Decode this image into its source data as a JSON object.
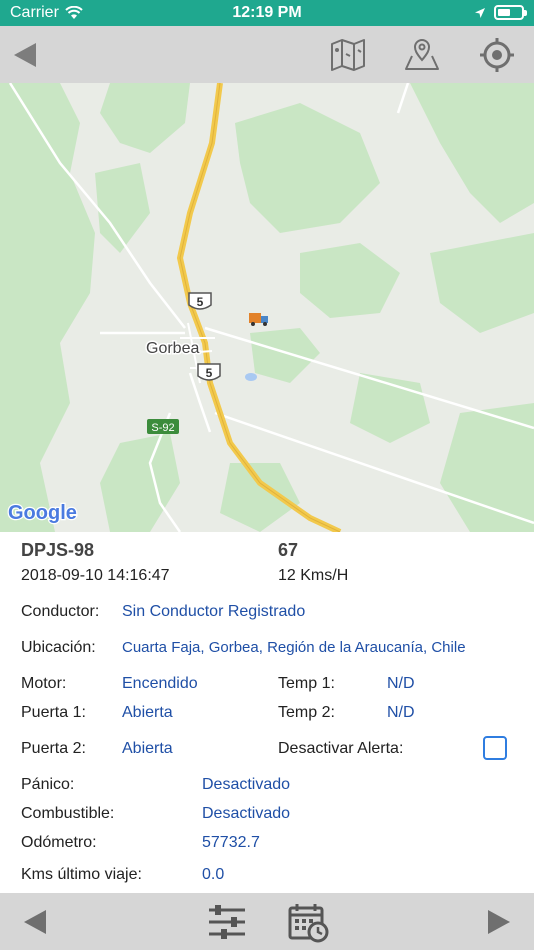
{
  "status_bar": {
    "carrier": "Carrier",
    "time": "12:19 PM",
    "battery_level": 0.55,
    "background_color": "#1fa88f"
  },
  "toolbar": {
    "back_icon": "triangle-left-icon",
    "icons": [
      "map-icon",
      "map-pin-icon",
      "crosshair-locate-icon"
    ]
  },
  "map": {
    "labels": {
      "town": "Gorbea",
      "route_5a": "5",
      "route_5b": "5",
      "route_s92": "S-92",
      "logo": "Google"
    }
  },
  "vehicle": {
    "plate": "DPJS-98",
    "number": "67",
    "datetime": "2018-09-10 14:16:47",
    "speed": "12 Kms/H"
  },
  "details": {
    "conductor_label": "Conductor:",
    "conductor_value": "Sin Conductor Registrado",
    "ubicacion_label": "Ubicación:",
    "ubicacion_value": "Cuarta Faja, Gorbea, Región de la Araucanía, Chile",
    "motor_label": "Motor:",
    "motor_value": "Encendido",
    "temp1_label": "Temp 1:",
    "temp1_value": "N/D",
    "puerta1_label": "Puerta 1:",
    "puerta1_value": "Abierta",
    "temp2_label": "Temp 2:",
    "temp2_value": "N/D",
    "puerta2_label": "Puerta 2:",
    "puerta2_value": "Abierta",
    "desactivar_label": "Desactivar Alerta:",
    "desactivar_checked": false,
    "panico_label": "Pánico:",
    "panico_value": "Desactivado",
    "combustible_label": "Combustible:",
    "combustible_value": "Desactivado",
    "odometro_label": "Odómetro:",
    "odometro_value": "57732.7",
    "kms_label": "Kms último viaje:",
    "kms_value": "0.0"
  },
  "bottom_bar": {
    "icons": [
      "triangle-left-icon",
      "sliders-icon",
      "calendar-clock-icon",
      "triangle-right-icon"
    ]
  },
  "colors": {
    "accent": "#1fa88f",
    "value_text": "#1f4fa6",
    "checkbox_border": "#2f7de0",
    "toolbar_bg": "#d6d6d6",
    "highway": "#f2c94c"
  }
}
